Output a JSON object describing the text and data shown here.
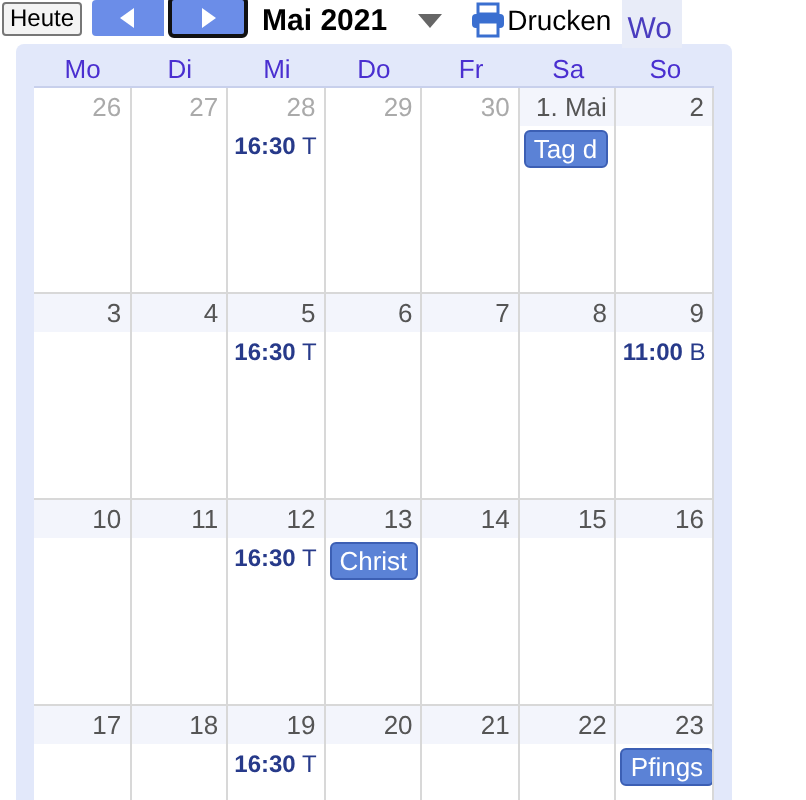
{
  "toolbar": {
    "today_button": "Heute",
    "period_title": "Mai 2021",
    "print_button": "Drucken",
    "view_tab": {
      "label": "Wo",
      "selected": false
    }
  },
  "weekdays": [
    "Mo",
    "Di",
    "Mi",
    "Do",
    "Fr",
    "Sa",
    "So"
  ],
  "weeks": [
    {
      "days": [
        {
          "date": "26",
          "in_month": false
        },
        {
          "date": "27",
          "in_month": false
        },
        {
          "date": "28",
          "in_month": false,
          "events": [
            {
              "kind": "timed",
              "time": "16:30",
              "title": "T"
            }
          ]
        },
        {
          "date": "29",
          "in_month": false
        },
        {
          "date": "30",
          "in_month": false
        },
        {
          "date": "1. Mai",
          "in_month": true,
          "events": [
            {
              "kind": "allday",
              "title": "Tag d"
            }
          ]
        },
        {
          "date": "2",
          "in_month": true
        }
      ]
    },
    {
      "days": [
        {
          "date": "3",
          "in_month": true
        },
        {
          "date": "4",
          "in_month": true
        },
        {
          "date": "5",
          "in_month": true,
          "events": [
            {
              "kind": "timed",
              "time": "16:30",
              "title": "T"
            }
          ]
        },
        {
          "date": "6",
          "in_month": true
        },
        {
          "date": "7",
          "in_month": true
        },
        {
          "date": "8",
          "in_month": true
        },
        {
          "date": "9",
          "in_month": true,
          "events": [
            {
              "kind": "timed",
              "time": "11:00",
              "title": "B"
            }
          ]
        }
      ]
    },
    {
      "days": [
        {
          "date": "10",
          "in_month": true
        },
        {
          "date": "11",
          "in_month": true
        },
        {
          "date": "12",
          "in_month": true,
          "events": [
            {
              "kind": "timed",
              "time": "16:30",
              "title": "T"
            }
          ]
        },
        {
          "date": "13",
          "in_month": true,
          "events": [
            {
              "kind": "allday",
              "title": "Christ"
            }
          ]
        },
        {
          "date": "14",
          "in_month": true
        },
        {
          "date": "15",
          "in_month": true
        },
        {
          "date": "16",
          "in_month": true
        }
      ]
    },
    {
      "days": [
        {
          "date": "17",
          "in_month": true
        },
        {
          "date": "18",
          "in_month": true
        },
        {
          "date": "19",
          "in_month": true,
          "events": [
            {
              "kind": "timed",
              "time": "16:30",
              "title": "T"
            }
          ]
        },
        {
          "date": "20",
          "in_month": true
        },
        {
          "date": "21",
          "in_month": true
        },
        {
          "date": "22",
          "in_month": true
        },
        {
          "date": "23",
          "in_month": true,
          "events": [
            {
              "kind": "allday",
              "title": "Pfings"
            }
          ]
        }
      ]
    }
  ]
}
